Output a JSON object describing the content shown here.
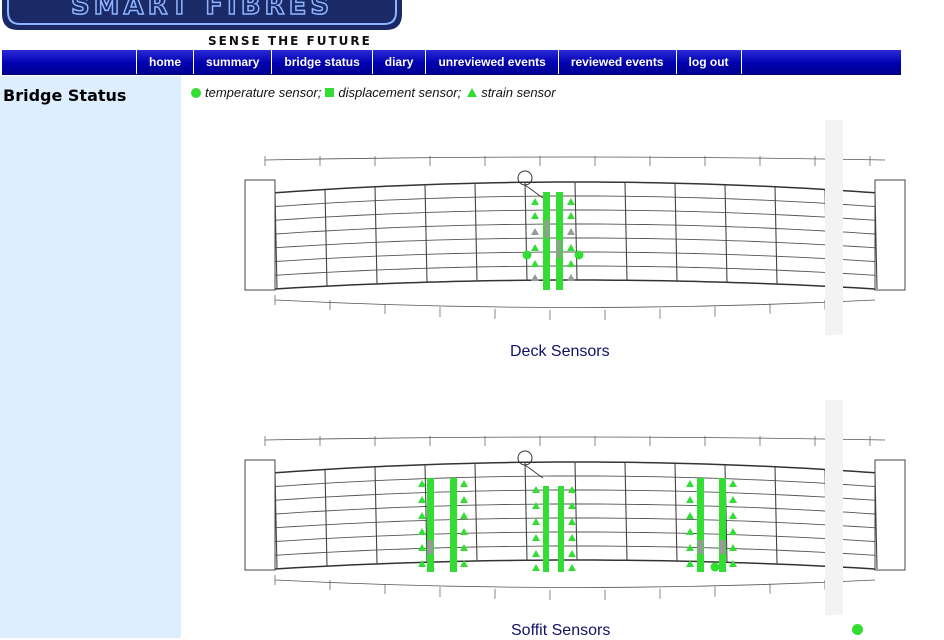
{
  "brand": {
    "logo_text": "SMART FIBRES",
    "tagline": "SENSE THE FUTURE"
  },
  "nav": {
    "items": [
      "home",
      "summary",
      "bridge status",
      "diary",
      "unreviewed events",
      "reviewed events",
      "log out"
    ]
  },
  "sidebar": {
    "title": "Bridge Status"
  },
  "legend": {
    "temperature": "temperature sensor;",
    "displacement": "displacement sensor;",
    "strain": "strain sensor"
  },
  "drawings": {
    "deck_caption": "Deck Sensors",
    "soffit_caption": "Soffit Sensors"
  },
  "colors": {
    "sensor": "#33dd33",
    "nav": "#0000b0",
    "sidebar": "#ddeeff",
    "inactive_sensor": "#999999"
  }
}
